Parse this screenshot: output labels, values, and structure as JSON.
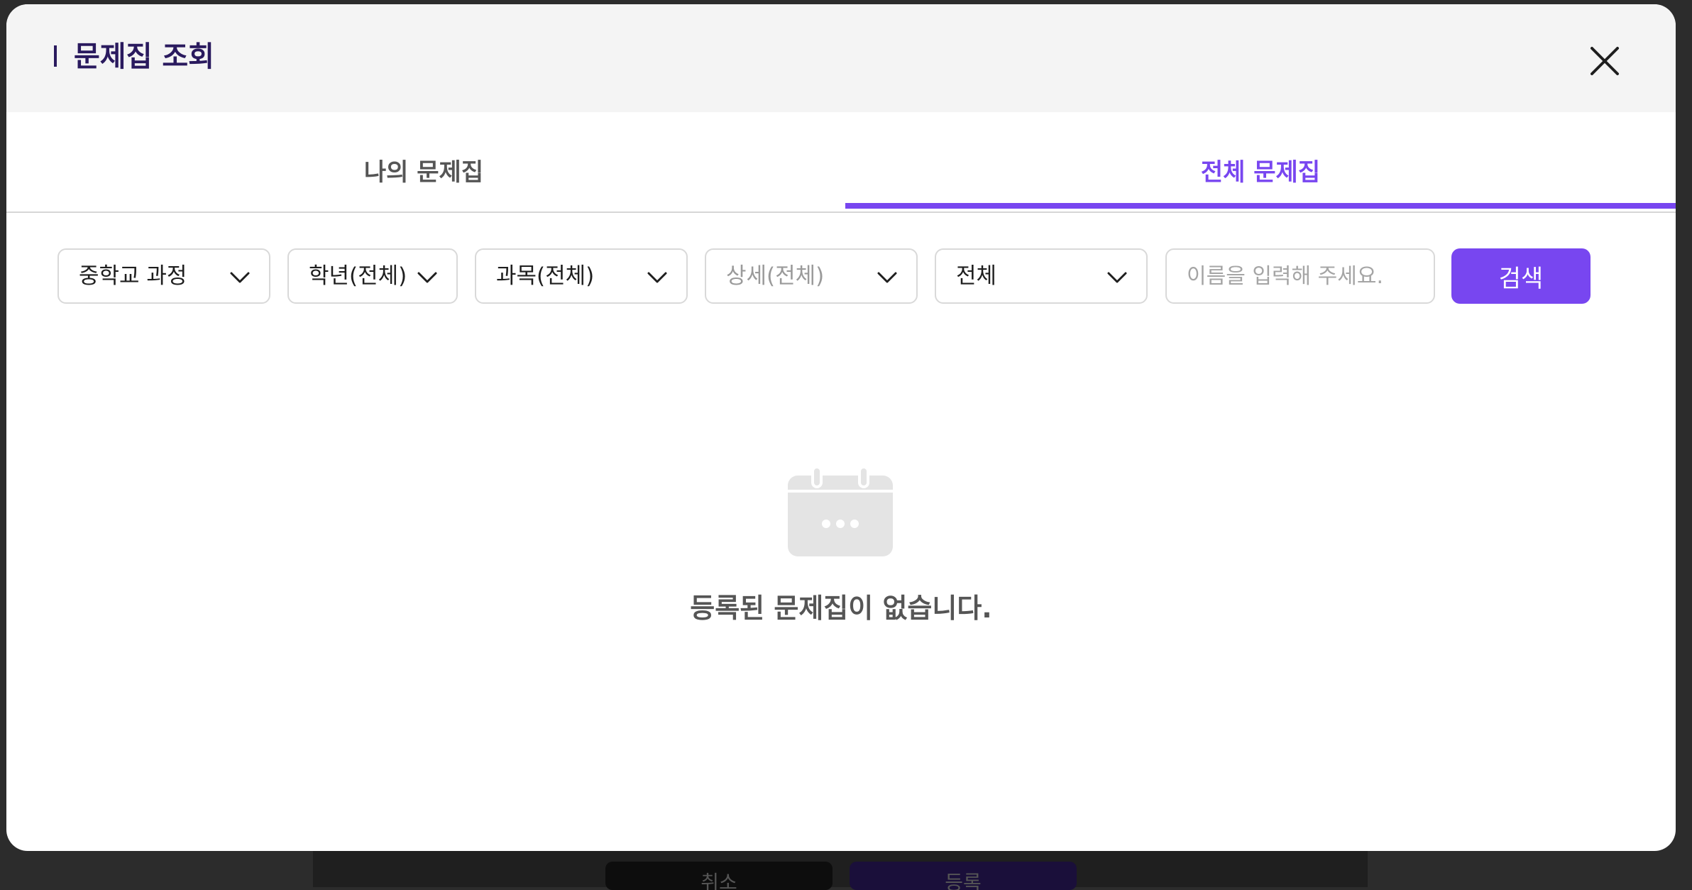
{
  "modal": {
    "title": "문제집 조회",
    "close_icon": "close-icon"
  },
  "tabs": [
    {
      "label": "나의 문제집",
      "active": false
    },
    {
      "label": "전체 문제집",
      "active": true
    }
  ],
  "filters": {
    "course": "중학교 과정",
    "grade": "학년(전체)",
    "subject": "과목(전체)",
    "detail": "상세(전체)",
    "scope": "전체",
    "name_placeholder": "이름을 입력해 주세요.",
    "search_label": "검색"
  },
  "empty_state": {
    "icon": "calendar-icon",
    "message": "등록된 문제집이 없습니다."
  },
  "background": {
    "cancel_label": "취소",
    "confirm_label": "등록"
  },
  "colors": {
    "accent": "#7846f0",
    "title": "#2a1a5e"
  }
}
